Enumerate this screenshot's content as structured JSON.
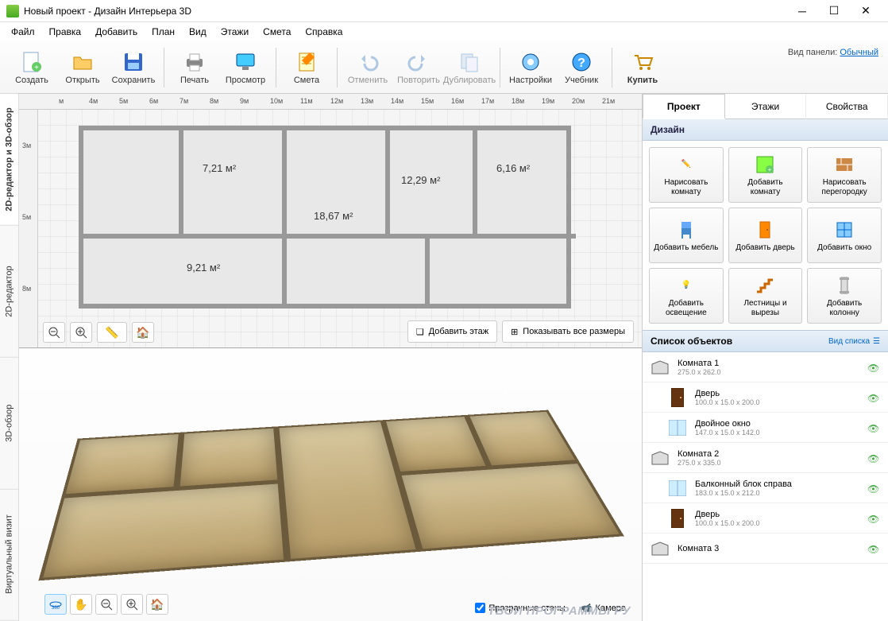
{
  "window": {
    "title": "Новый проект - Дизайн Интерьера 3D"
  },
  "menu": [
    "Файл",
    "Правка",
    "Добавить",
    "План",
    "Вид",
    "Этажи",
    "Смета",
    "Справка"
  ],
  "toolbar": {
    "create": "Создать",
    "open": "Открыть",
    "save": "Сохранить",
    "print": "Печать",
    "preview": "Просмотр",
    "budget": "Смета",
    "undo": "Отменить",
    "redo": "Повторить",
    "duplicate": "Дублировать",
    "settings": "Настройки",
    "tutorial": "Учебник",
    "buy": "Купить",
    "panel_mode_label": "Вид панели:",
    "panel_mode_value": "Обычный"
  },
  "side_tabs": {
    "t1": "2D-редактор и 3D-обзор",
    "t2": "2D-редактор",
    "t3": "3D-обзор",
    "t4": "Виртуальный визит"
  },
  "ruler_top": [
    "м",
    "4м",
    "5м",
    "6м",
    "7м",
    "8м",
    "9м",
    "10м",
    "11м",
    "12м",
    "13м",
    "14м",
    "15м",
    "16м",
    "17м",
    "18м",
    "19м",
    "20м",
    "21м"
  ],
  "ruler_left": [
    "3м",
    "5м",
    "8м"
  ],
  "rooms": {
    "r1": "7,21 м²",
    "r2": "18,67 м²",
    "r3": "12,29 м²",
    "r4": "6,16 м²",
    "r5": "9,21 м²"
  },
  "plan_actions": {
    "add_floor": "Добавить этаж",
    "show_dims": "Показывать все размеры"
  },
  "view3d_opts": {
    "transparent_walls": "Прозрачные стены",
    "camera": "Камера"
  },
  "right_tabs": {
    "project": "Проект",
    "floors": "Этажи",
    "properties": "Свойства"
  },
  "design_head": "Дизайн",
  "tools": {
    "draw_room": "Нарисовать комнату",
    "add_room": "Добавить комнату",
    "draw_partition": "Нарисовать перегородку",
    "add_furniture": "Добавить мебель",
    "add_door": "Добавить дверь",
    "add_window": "Добавить окно",
    "add_light": "Добавить освещение",
    "stairs": "Лестницы и вырезы",
    "add_column": "Добавить колонну"
  },
  "objects_head": {
    "title": "Список объектов",
    "view_mode": "Вид списка"
  },
  "objects": [
    {
      "name": "Комната 1",
      "dim": "275.0 x 262.0",
      "type": "room"
    },
    {
      "name": "Дверь",
      "dim": "100.0 x 15.0 x 200.0",
      "type": "door",
      "indent": true
    },
    {
      "name": "Двойное окно",
      "dim": "147.0 x 15.0 x 142.0",
      "type": "window",
      "indent": true
    },
    {
      "name": "Комната 2",
      "dim": "275.0 x 335.0",
      "type": "room"
    },
    {
      "name": "Балконный блок справа",
      "dim": "183.0 x 15.0 x 212.0",
      "type": "window",
      "indent": true
    },
    {
      "name": "Дверь",
      "dim": "100.0 x 15.0 x 200.0",
      "type": "door",
      "indent": true
    },
    {
      "name": "Комната 3",
      "dim": "",
      "type": "room"
    }
  ],
  "watermark": "ТВОИ ПРОГРАММЫ РУ"
}
